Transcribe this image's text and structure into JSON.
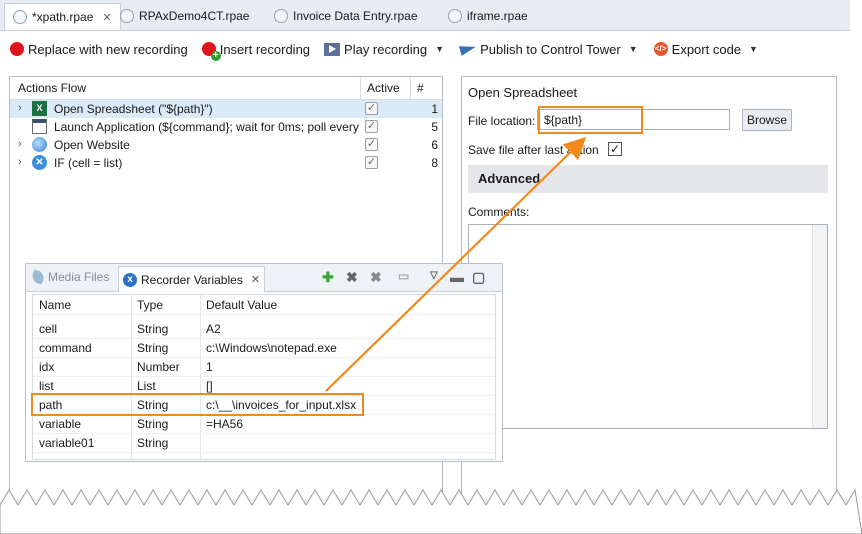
{
  "tabs": [
    {
      "label": "*xpath.rpae",
      "active": true,
      "closable": true
    },
    {
      "label": "RPAxDemo4CT.rpae",
      "active": false
    },
    {
      "label": "Invoice Data Entry.rpae",
      "active": false
    },
    {
      "label": "iframe.rpae",
      "active": false
    }
  ],
  "toolbar": {
    "replace": "Replace with new recording",
    "insert": "Insert recording",
    "play": "Play recording",
    "publish": "Publish to Control Tower",
    "export": "Export code"
  },
  "actions_flow": {
    "headers": {
      "name": "Actions Flow",
      "active": "Active",
      "num": "#"
    },
    "rows": [
      {
        "label": "Open Spreadsheet (\"${path}\")",
        "icon": "excel-icon",
        "num": "1",
        "selected": true,
        "expandable": true,
        "checked": true
      },
      {
        "label": "Launch Application (${command}; wait for 0ms; poll every",
        "icon": "application-icon",
        "num": "5",
        "selected": false,
        "expandable": false,
        "checked": true
      },
      {
        "label": "Open Website",
        "icon": "globe-icon",
        "num": "6",
        "selected": false,
        "expandable": true,
        "checked": true
      },
      {
        "label": "IF (cell = list)",
        "icon": "if-icon",
        "num": "8",
        "selected": false,
        "expandable": true,
        "checked": true
      }
    ]
  },
  "recorder": {
    "tab_media": "Media Files",
    "tab_vars": "Recorder Variables",
    "headers": {
      "name": "Name",
      "type": "Type",
      "default": "Default Value"
    },
    "rows": [
      {
        "name": "cell",
        "type": "String",
        "value": "A2"
      },
      {
        "name": "command",
        "type": "String",
        "value": "c:\\Windows\\notepad.exe"
      },
      {
        "name": "idx",
        "type": "Number",
        "value": "1"
      },
      {
        "name": "list",
        "type": "List",
        "value": "[]"
      },
      {
        "name": "path",
        "type": "String",
        "value": "c:\\__\\invoices_for_input.xlsx",
        "highlight": true
      },
      {
        "name": "variable",
        "type": "String",
        "value": "=HA56"
      },
      {
        "name": "variable01",
        "type": "String",
        "value": ""
      }
    ]
  },
  "properties": {
    "title": "Open Spreadsheet",
    "file_location_label": "File location:",
    "file_location_value": "${path}",
    "browse": "Browse",
    "save_label": "Save file after last action",
    "save_checked": true,
    "advanced": "Advanced",
    "comments_label": "Comments:"
  },
  "colors": {
    "highlight": "#f08a1c",
    "selection": "#dbeaf9"
  }
}
